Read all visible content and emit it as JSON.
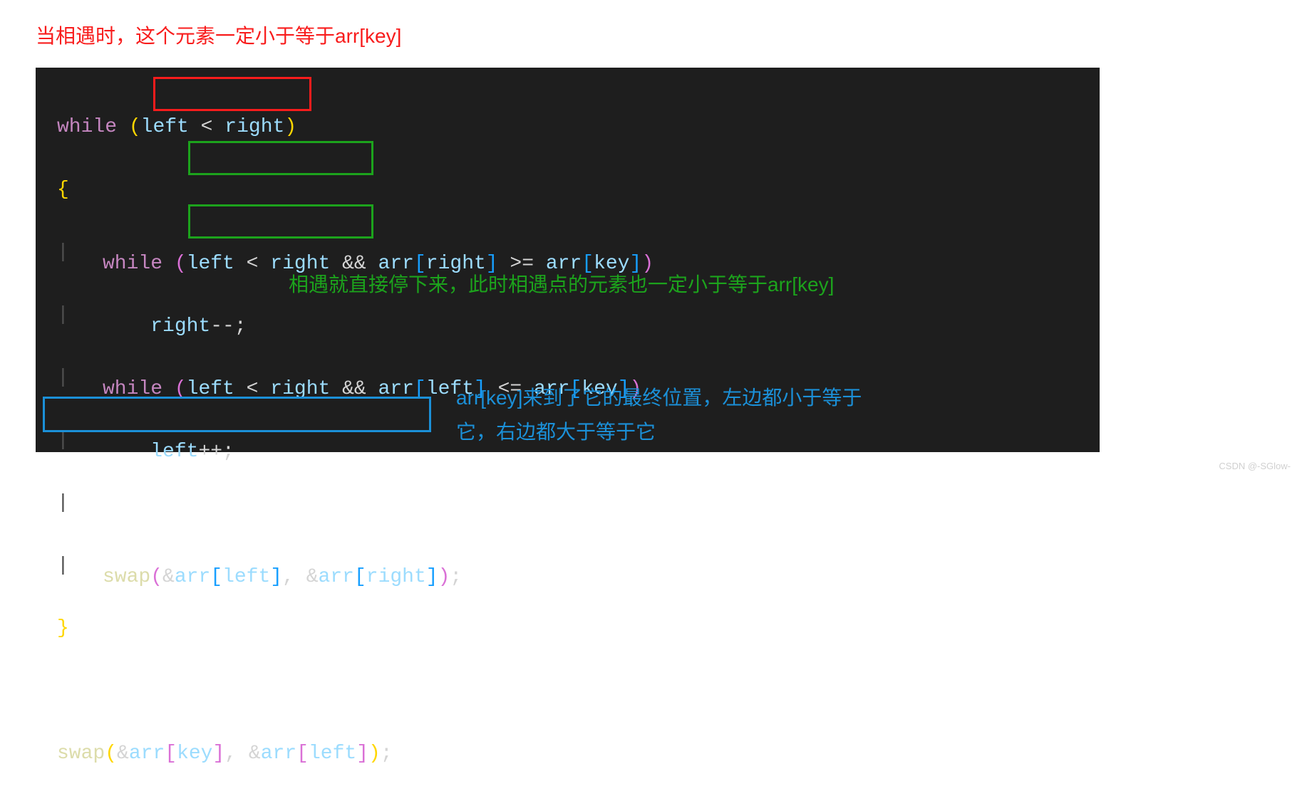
{
  "annotations": {
    "top_red": "当相遇时，这个元素一定小于等于arr[key]",
    "mid_green": "相遇就直接停下来，此时相遇点的元素也一定小于等于arr[key]",
    "bottom_blue_l1": "arr[key]来到了它的最终位置，左边都小于等于",
    "bottom_blue_l2": "它，右边都大于等于它"
  },
  "code": {
    "l1_while": "while",
    "l1_lp": "(",
    "l1_left": "left",
    "l1_lt": "<",
    "l1_right": "right",
    "l1_rp": ")",
    "l2_brace": "{",
    "l3_while": "while",
    "l3_lp": "(",
    "l3_left": "left",
    "l3_lt": "<",
    "l3_right": "right",
    "l3_and": "&&",
    "l3_arr1": "arr",
    "l3_lb1": "[",
    "l3_right2": "right",
    "l3_rb1": "]",
    "l3_ge": ">=",
    "l3_arr2": "arr",
    "l3_lb2": "[",
    "l3_key": "key",
    "l3_rb2": "]",
    "l3_rp": ")",
    "l4_right": "right",
    "l4_dec": "--;",
    "l5_while": "while",
    "l5_lp": "(",
    "l5_left": "left",
    "l5_lt": "<",
    "l5_right": "right",
    "l5_and": "&&",
    "l5_arr1": "arr",
    "l5_lb1": "[",
    "l5_left2": "left",
    "l5_rb1": "]",
    "l5_le": "<=",
    "l5_arr2": "arr",
    "l5_lb2": "[",
    "l5_key": "key",
    "l5_rb2": "]",
    "l5_rp": ")",
    "l6_left": "left",
    "l6_inc": "++;",
    "l7_swap": "swap",
    "l7_lp": "(",
    "l7_amp1": "&",
    "l7_arr1": "arr",
    "l7_lb1": "[",
    "l7_left": "left",
    "l7_rb1": "]",
    "l7_comma": ", ",
    "l7_amp2": "&",
    "l7_arr2": "arr",
    "l7_lb2": "[",
    "l7_right": "right",
    "l7_rb2": "]",
    "l7_rp": ")",
    "l7_semi": ";",
    "l8_brace": "}",
    "l9_swap": "swap",
    "l9_lp": "(",
    "l9_amp1": "&",
    "l9_arr1": "arr",
    "l9_lb1": "[",
    "l9_key": "key",
    "l9_rb1": "]",
    "l9_comma": ", ",
    "l9_amp2": "&",
    "l9_arr2": "arr",
    "l9_lb2": "[",
    "l9_left": "left",
    "l9_rb2": "]",
    "l9_rp": ")",
    "l9_semi": ";"
  },
  "watermark": "CSDN @-SGlow-"
}
